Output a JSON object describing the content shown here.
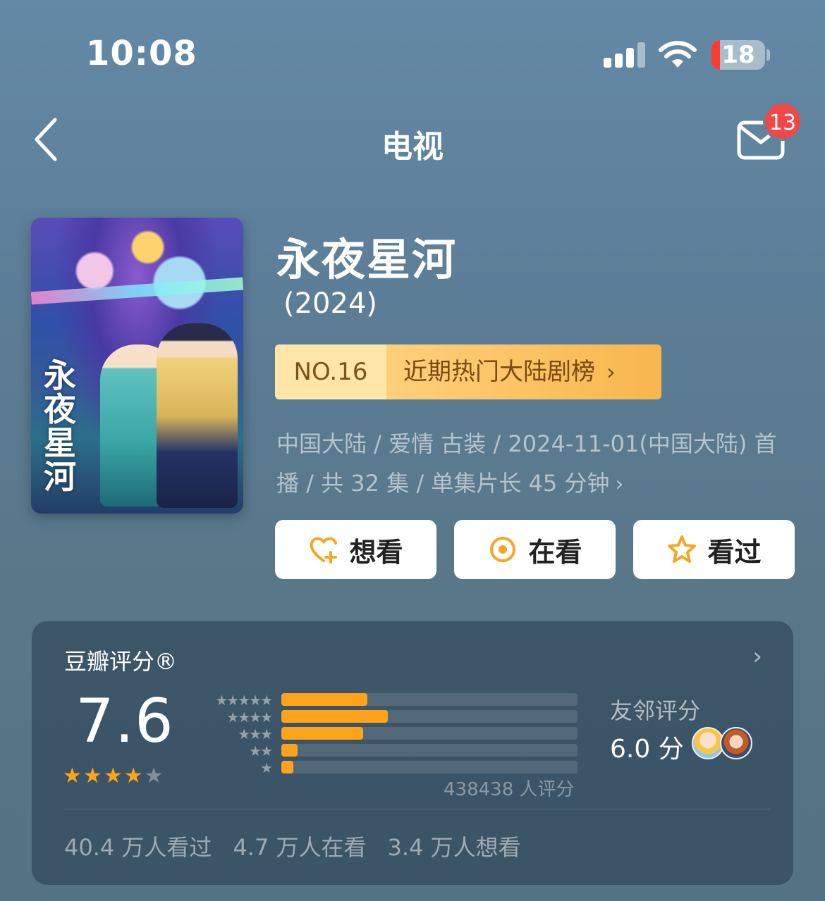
{
  "status": {
    "time": "10:08",
    "battery": "18"
  },
  "nav": {
    "title": "电视",
    "mail_badge": "13"
  },
  "show": {
    "poster_title": "永夜星河",
    "title": "永夜星河",
    "year": "(2024)",
    "rank_no": "NO.16",
    "rank_name": "近期热门大陆剧榜",
    "meta": "中国大陆 / 爱情 古装 / 2024-11-01(中国大陆) 首播 / 共 32 集 / 单集片长 45 分钟"
  },
  "actions": [
    {
      "label": "想看",
      "icon": "heart-plus-icon"
    },
    {
      "label": "在看",
      "icon": "target-icon"
    },
    {
      "label": "看过",
      "icon": "star-icon"
    }
  ],
  "rating": {
    "label": "豆瓣评分®",
    "score": "7.6",
    "stars": 3.8,
    "distribution": [
      {
        "stars": "★★★★★",
        "fraction": 0.29
      },
      {
        "stars": "★★★★",
        "fraction": 0.36
      },
      {
        "stars": "★★★",
        "fraction": 0.275
      },
      {
        "stars": "★★",
        "fraction": 0.055
      },
      {
        "stars": "★",
        "fraction": 0.04
      }
    ],
    "votes": "438438 人评分",
    "friend_label": "友邻评分",
    "friend_score": "6.0 分",
    "counts": [
      "40.4 万人看过",
      "4.7 万人在看",
      "3.4 万人想看"
    ]
  },
  "colors": {
    "accent": "#ffa31a",
    "badge": "#f04848",
    "rank_bg": "#f7b64d"
  }
}
